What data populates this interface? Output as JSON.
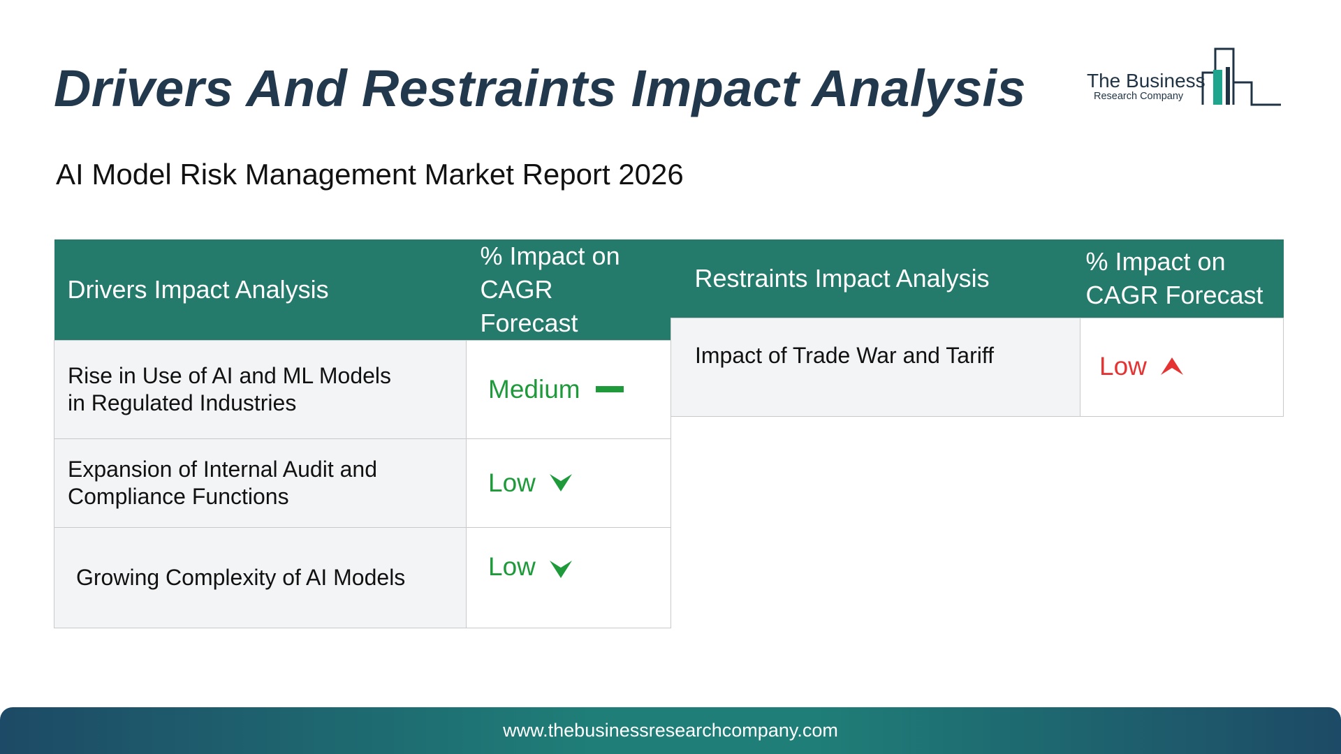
{
  "title": "Drivers And Restraints Impact Analysis",
  "subtitle": "AI Model Risk Management Market Report 2026",
  "logo": {
    "line1": "The Business",
    "line2": "Research Company"
  },
  "drivers": {
    "header_label": "Drivers Impact Analysis",
    "header_impact_line1": "% Impact on",
    "header_impact_line2": "CAGR Forecast",
    "rows": [
      {
        "line1": "Rise in Use of AI and ML Models",
        "line2": "in Regulated Industries",
        "impact": "Medium",
        "indicator": "dash-icon"
      },
      {
        "line1": "Expansion of Internal Audit and",
        "line2": "Compliance Functions",
        "impact": "Low",
        "indicator": "arrow-down-icon"
      },
      {
        "line1": "Growing Complexity of AI Models",
        "line2": "",
        "impact": "Low",
        "indicator": "arrow-down-icon"
      }
    ]
  },
  "restraints": {
    "header_label": "Restraints Impact Analysis",
    "header_impact_line1": "% Impact on",
    "header_impact_line2": "CAGR Forecast",
    "rows": [
      {
        "line1": "Impact of Trade War and Tariff",
        "impact": "Low",
        "indicator": "arrow-up-icon"
      }
    ]
  },
  "colors": {
    "header_bg": "#247a6b",
    "title": "#22384d",
    "positive": "#1e9a3b",
    "negative": "#e53333"
  },
  "footer": {
    "url": "www.thebusinessresearchcompany.com"
  }
}
